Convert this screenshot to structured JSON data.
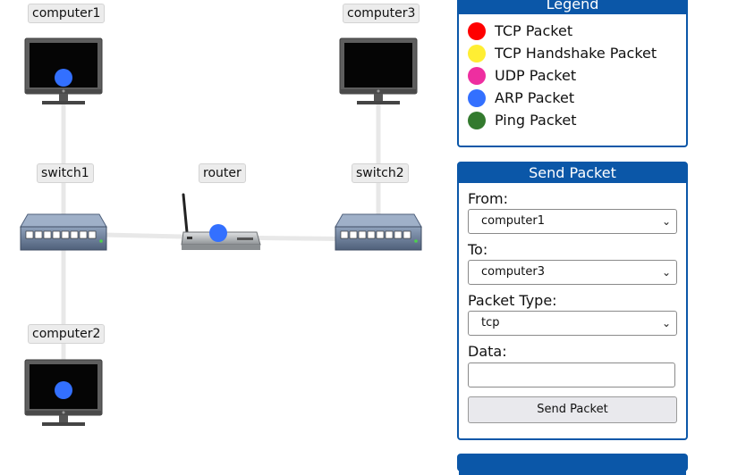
{
  "nodes": [
    {
      "id": "computer1",
      "label": "computer1",
      "kind": "computer"
    },
    {
      "id": "computer2",
      "label": "computer2",
      "kind": "computer"
    },
    {
      "id": "computer3",
      "label": "computer3",
      "kind": "computer"
    },
    {
      "id": "switch1",
      "label": "switch1",
      "kind": "switch"
    },
    {
      "id": "switch2",
      "label": "switch2",
      "kind": "switch"
    },
    {
      "id": "router",
      "label": "router",
      "kind": "router"
    }
  ],
  "links": [
    [
      "computer1",
      "switch1"
    ],
    [
      "computer2",
      "switch1"
    ],
    [
      "switch1",
      "router"
    ],
    [
      "router",
      "switch2"
    ],
    [
      "switch2",
      "computer3"
    ]
  ],
  "packets": [
    {
      "at": "computer1",
      "type": "arp"
    },
    {
      "at": "computer2",
      "type": "arp"
    },
    {
      "at": "router",
      "type": "arp"
    }
  ],
  "colors": {
    "accent": "#0b57a8",
    "link": "#e8e8e8"
  },
  "legend": {
    "title": "Legend",
    "items": [
      {
        "label": "TCP Packet",
        "color": "#ff0000"
      },
      {
        "label": "TCP Handshake Packet",
        "color": "#ffee33"
      },
      {
        "label": "UDP Packet",
        "color": "#ee2ea0"
      },
      {
        "label": "ARP Packet",
        "color": "#3370ff"
      },
      {
        "label": "Ping Packet",
        "color": "#337a2e"
      }
    ]
  },
  "send_packet": {
    "title": "Send Packet",
    "from_label": "From:",
    "from_value": "computer1",
    "to_label": "To:",
    "to_value": "computer3",
    "type_label": "Packet Type:",
    "type_value": "tcp",
    "data_label": "Data:",
    "data_value": "",
    "button_label": "Send Packet"
  }
}
